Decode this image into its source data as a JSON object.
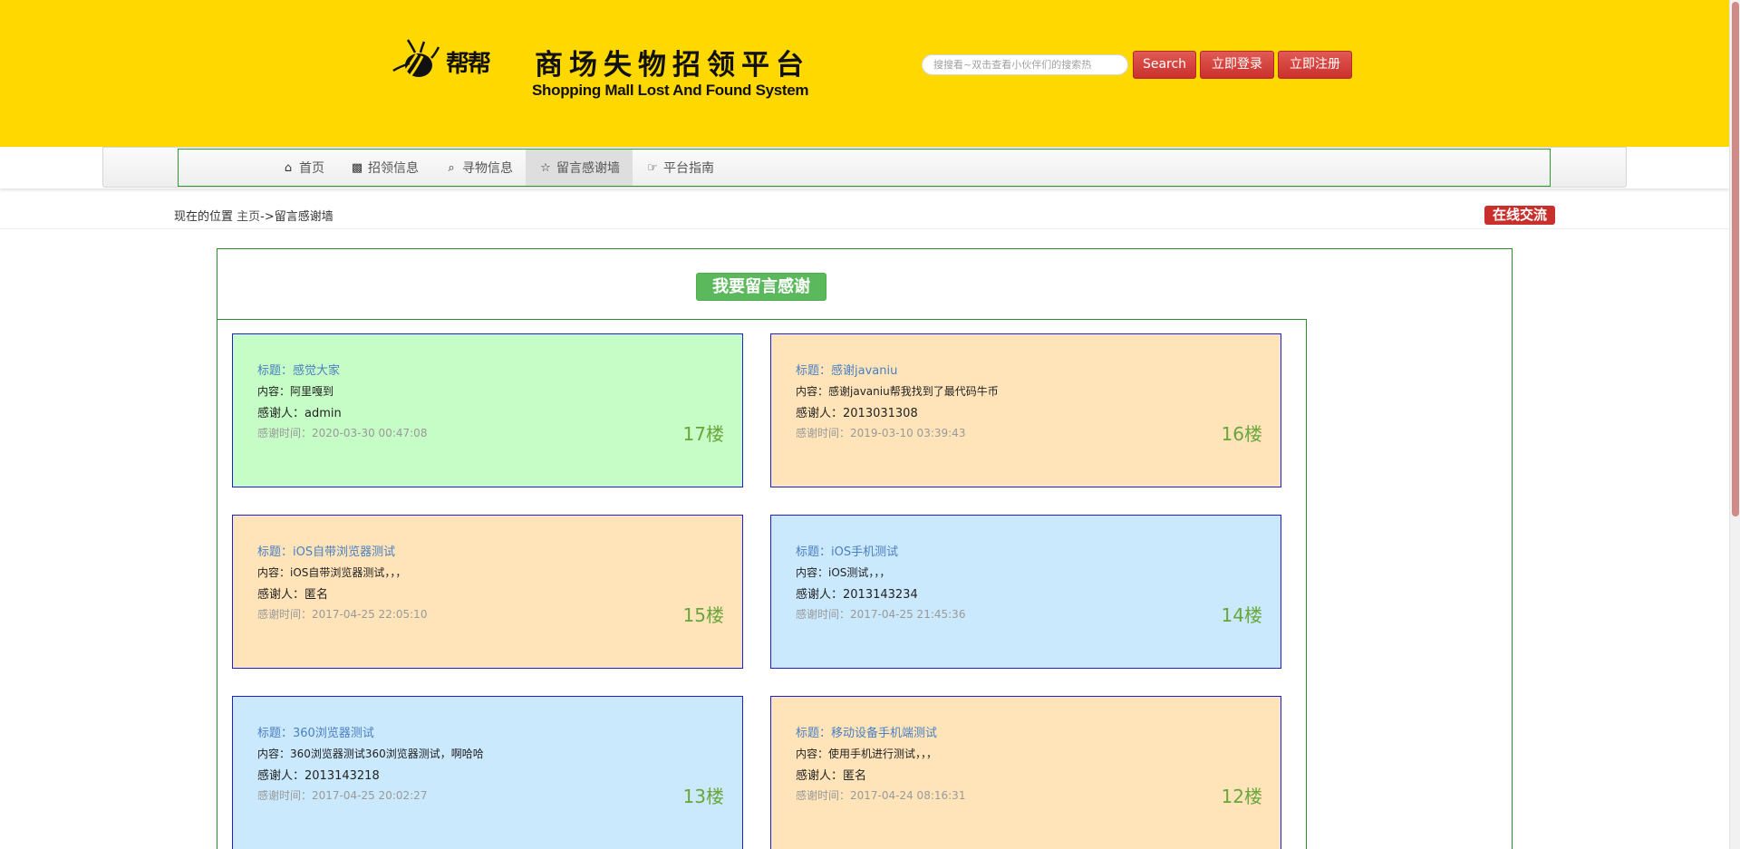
{
  "header": {
    "logo_bang": "帮帮",
    "logo_title": "商场失物招领平台",
    "logo_subtitle": "Shopping Mall Lost And Found System",
    "search_placeholder": "搜搜看~双击查看小伙伴们的搜索热",
    "search_button": "Search",
    "login_button": "立即登录",
    "register_button": "立即注册",
    "button_color": "#c9302c",
    "background_color": "#ffd800"
  },
  "nav": {
    "items": [
      {
        "label": "首页",
        "icon": "home-icon"
      },
      {
        "label": "招领信息",
        "icon": "picture-icon"
      },
      {
        "label": "寻物信息",
        "icon": "search-icon"
      },
      {
        "label": "留言感谢墙",
        "icon": "star-icon"
      },
      {
        "label": "平台指南",
        "icon": "hand-point-icon"
      }
    ],
    "active_index": 3
  },
  "location": {
    "prefix": "现在的位置",
    "home": "主页",
    "separator": "->",
    "current": "留言感谢墙",
    "chat_badge": "在线交流"
  },
  "wall": {
    "leave_message_button": "我要留言感谢",
    "cards": [
      {
        "title": "标题：感觉大家",
        "content": "内容：阿里嘎到",
        "person": "感谢人：admin",
        "time": "感谢时间：2020-03-30 00:47:08",
        "floor": "17楼",
        "color": "#c6fcc6"
      },
      {
        "title": "标题：感谢javaniu",
        "content": "内容：感谢javaniu帮我找到了最代码牛币",
        "person": "感谢人：2013031308",
        "time": "感谢时间：2019-03-10 03:39:43",
        "floor": "16楼",
        "color": "#ffe4ba"
      },
      {
        "title": "标题：iOS自带浏览器测试",
        "content": "内容：iOS自带浏览器测试，，，",
        "person": "感谢人：匿名",
        "time": "感谢时间：2017-04-25 22:05:10",
        "floor": "15楼",
        "color": "#ffe4ba"
      },
      {
        "title": "标题：iOS手机测试",
        "content": "内容：iOS测试，，，",
        "person": "感谢人：2013143234",
        "time": "感谢时间：2017-04-25 21:45:36",
        "floor": "14楼",
        "color": "#cbe9fd"
      },
      {
        "title": "标题：360浏览器测试",
        "content": "内容：360浏览器测试360浏览器测试，啊哈哈",
        "person": "感谢人：2013143218",
        "time": "感谢时间：2017-04-25 20:02:27",
        "floor": "13楼",
        "color": "#cbe9fd"
      },
      {
        "title": "标题：移动设备手机端测试",
        "content": "内容：使用手机进行测试，，，",
        "person": "感谢人：匿名",
        "time": "感谢时间：2017-04-24 08:16:31",
        "floor": "12楼",
        "color": "#ffe4ba"
      }
    ]
  }
}
